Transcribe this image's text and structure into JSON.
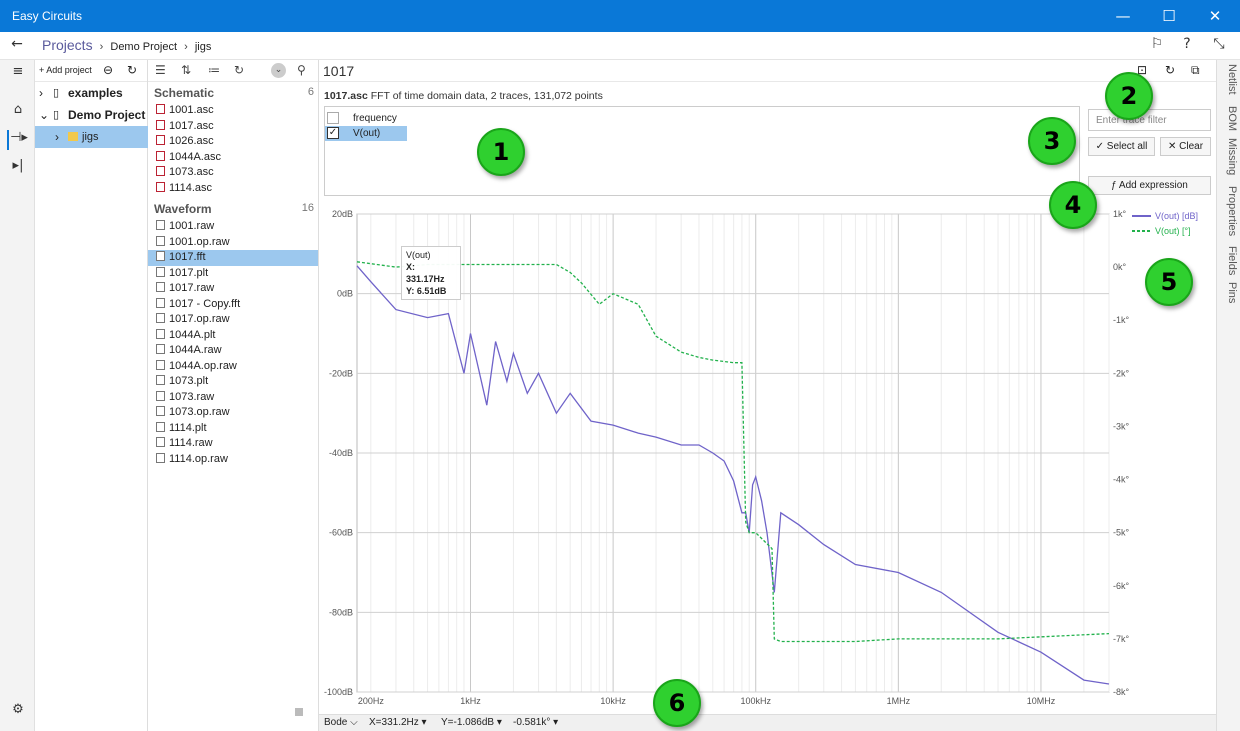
{
  "app": {
    "title": "Easy Circuits"
  },
  "window": {
    "minimize": "—",
    "maximize": "☐",
    "close": "✕"
  },
  "breadcrumb": {
    "root": "Projects",
    "project": "Demo Project",
    "folder": "jigs"
  },
  "project_pane": {
    "add_label": "+ Add project",
    "items": [
      {
        "label": "examples",
        "level": 0
      },
      {
        "label": "Demo Project",
        "level": 0
      },
      {
        "label": "jigs",
        "level": 1
      }
    ]
  },
  "files": {
    "schematic": {
      "label": "Schematic",
      "count": "6",
      "items": [
        "1001.asc",
        "1017.asc",
        "1026.asc",
        "1044A.asc",
        "1073.asc",
        "1114.asc"
      ]
    },
    "waveform": {
      "label": "Waveform",
      "count": "16",
      "items": [
        "1001.raw",
        "1001.op.raw",
        "1017.fft",
        "1017.plt",
        "1017.raw",
        "1017 - Copy.fft",
        "1017.op.raw",
        "1044A.plt",
        "1044A.raw",
        "1044A.op.raw",
        "1073.plt",
        "1073.raw",
        "1073.op.raw",
        "1114.plt",
        "1114.raw",
        "1114.op.raw"
      ]
    },
    "selected": "1017.fft"
  },
  "main": {
    "doc_name": "1017",
    "info_file": "1017.asc",
    "info_text": "FFT of time domain data, 2 traces, 131,072 points",
    "traces": [
      {
        "label": "frequency",
        "checked": false
      },
      {
        "label": "V(out)",
        "checked": true
      }
    ],
    "filter_placeholder": "Enter trace filter",
    "select_all": "✓  Select all",
    "clear": "✕  Clear",
    "add_expression": "ƒ  Add expression"
  },
  "tooltip": {
    "title": "V(out)",
    "x": "X: 331.17Hz",
    "y": "Y: 6.51dB"
  },
  "status": {
    "mode": "Bode ⌵",
    "x": "X=331.2Hz ▾",
    "y": "Y=-1.086dB ▾",
    "phase": "-0.581k° ▾"
  },
  "right_tabs": [
    "Netlist",
    "BOM",
    "Missing",
    "Properties",
    "Fields",
    "Pins"
  ],
  "markers": [
    "1",
    "2",
    "3",
    "4",
    "5",
    "6"
  ],
  "chart_data": {
    "type": "line",
    "xscale": "log",
    "xlim": [
      160,
      30000000
    ],
    "x_ticks": [
      "200Hz",
      "1kHz",
      "10kHz",
      "100kHz",
      "1MHz",
      "10MHz"
    ],
    "y_left_ticks": [
      "20dB",
      "0dB",
      "-20dB",
      "-40dB",
      "-60dB",
      "-80dB",
      "-100dB"
    ],
    "ylim_left": [
      -100,
      20
    ],
    "y_right_ticks": [
      "1k°",
      "0k°",
      "-1k°",
      "-2k°",
      "-3k°",
      "-4k°",
      "-5k°",
      "-6k°",
      "-7k°",
      "-8k°"
    ],
    "ylim_right": [
      -8000,
      1000
    ],
    "legend": "top-right",
    "series": [
      {
        "name": "V(out) [dB]",
        "axis": "left",
        "color": "#6f63c9",
        "style": "solid",
        "x": [
          160,
          200,
          300,
          500,
          700,
          900,
          1000,
          1300,
          1500,
          1800,
          2000,
          2500,
          3000,
          4000,
          5000,
          7000,
          10000,
          15000,
          20000,
          30000,
          40000,
          50000,
          60000,
          70000,
          80000,
          85000,
          90000,
          95000,
          100000,
          110000,
          120000,
          135000,
          150000,
          200000,
          300000,
          500000,
          1000000,
          2000000,
          5000000,
          10000000,
          20000000,
          30000000
        ],
        "y": [
          7,
          3,
          -4,
          -6,
          -5,
          -20,
          -10,
          -28,
          -12,
          -22,
          -15,
          -25,
          -20,
          -30,
          -25,
          -32,
          -33,
          -35,
          -36,
          -38,
          -38,
          -40,
          -42,
          -47,
          -55,
          -55,
          -60,
          -48,
          -46,
          -52,
          -60,
          -75,
          -55,
          -58,
          -63,
          -68,
          -70,
          -75,
          -85,
          -90,
          -97,
          -98
        ]
      },
      {
        "name": "V(out) [°]",
        "axis": "right",
        "color": "#22b14c",
        "style": "dashed",
        "x": [
          160,
          300,
          500,
          1000,
          2000,
          4000,
          5000,
          6000,
          8000,
          10000,
          15000,
          20000,
          30000,
          40000,
          50000,
          70000,
          80000,
          85000,
          90000,
          100000,
          130000,
          135000,
          150000,
          200000,
          500000,
          1000000,
          5000000,
          30000000
        ],
        "y": [
          100,
          0,
          50,
          50,
          50,
          50,
          -100,
          -300,
          -700,
          -500,
          -700,
          -1300,
          -1600,
          -1700,
          -1750,
          -1800,
          -1800,
          -4800,
          -5000,
          -5000,
          -5300,
          -7000,
          -7050,
          -7050,
          -7050,
          -7000,
          -7000,
          -6900
        ]
      }
    ]
  }
}
